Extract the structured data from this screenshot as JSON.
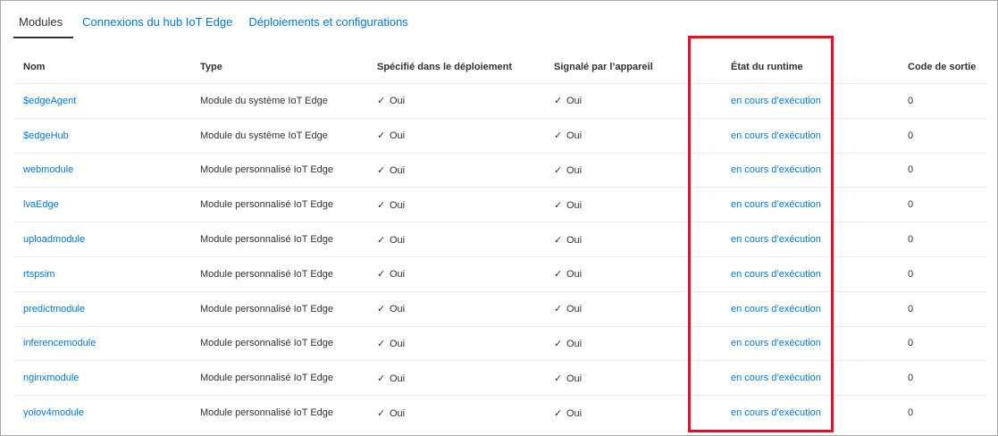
{
  "tabs": [
    {
      "label": "Modules",
      "active": true
    },
    {
      "label": "Connexions du hub IoT Edge",
      "active": false
    },
    {
      "label": "Déploiements et configurations",
      "active": false
    }
  ],
  "table": {
    "headers": {
      "name": "Nom",
      "type": "Type",
      "specified": "Spécifié dans le déploiement",
      "reported": "Signalé par l’appareil",
      "runtime": "État du runtime",
      "exit": "Code de sortie"
    },
    "rows": [
      {
        "name": "$edgeAgent",
        "type": "Module du système IoT Edge",
        "specified": "Oui",
        "reported": "Oui",
        "runtime": "en cours d’exécution",
        "exit": "0"
      },
      {
        "name": "$edgeHub",
        "type": "Module du système IoT Edge",
        "specified": "Oui",
        "reported": "Oui",
        "runtime": "en cours d’exécution",
        "exit": "0"
      },
      {
        "name": "webmodule",
        "type": "Module personnalisé IoT Edge",
        "specified": "Oui",
        "reported": "Oui",
        "runtime": "en cours d’exécution",
        "exit": "0"
      },
      {
        "name": "lvaEdge",
        "type": "Module personnalisé IoT Edge",
        "specified": "Oui",
        "reported": "Oui",
        "runtime": "en cours d’exécution",
        "exit": "0"
      },
      {
        "name": "uploadmodule",
        "type": "Module personnalisé IoT Edge",
        "specified": "Oui",
        "reported": "Oui",
        "runtime": "en cours d’exécution",
        "exit": "0"
      },
      {
        "name": "rtspsim",
        "type": "Module personnalisé IoT Edge",
        "specified": "Oui",
        "reported": "Oui",
        "runtime": "en cours d’exécution",
        "exit": "0"
      },
      {
        "name": "predictmodule",
        "type": "Module personnalisé IoT Edge",
        "specified": "Oui",
        "reported": "Oui",
        "runtime": "en cours d’exécution",
        "exit": "0"
      },
      {
        "name": "inferencemodule",
        "type": "Module personnalisé IoT Edge",
        "specified": "Oui",
        "reported": "Oui",
        "runtime": "en cours d’exécution",
        "exit": "0"
      },
      {
        "name": "nginxmodule",
        "type": "Module personnalisé IoT Edge",
        "specified": "Oui",
        "reported": "Oui",
        "runtime": "en cours d’exécution",
        "exit": "0"
      },
      {
        "name": "yolov4module",
        "type": "Module personnalisé IoT Edge",
        "specified": "Oui",
        "reported": "Oui",
        "runtime": "en cours d’exécution",
        "exit": "0"
      }
    ]
  },
  "colors": {
    "link": "#0078d4",
    "highlight_border": "#e81123",
    "text": "#323130"
  },
  "icons": {
    "check": "check-icon"
  }
}
